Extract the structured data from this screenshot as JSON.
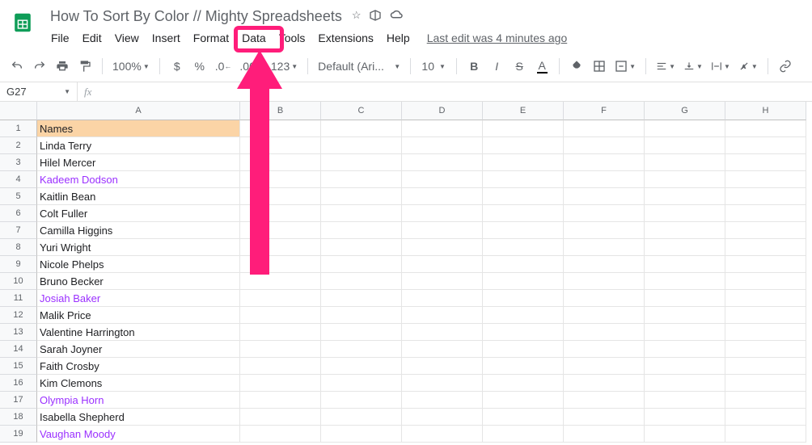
{
  "doc": {
    "title": "How To Sort By Color // Mighty Spreadsheets"
  },
  "menubar": {
    "file": "File",
    "edit": "Edit",
    "view": "View",
    "insert": "Insert",
    "format": "Format",
    "data": "Data",
    "tools": "Tools",
    "extensions": "Extensions",
    "help": "Help",
    "last_edit": "Last edit was 4 minutes ago"
  },
  "toolbar": {
    "zoom": "100%",
    "currency": "$",
    "percent": "%",
    "dec_less": ".0",
    "dec_more": ".00",
    "numfmt": "123",
    "font": "Default (Ari...",
    "font_size": "10"
  },
  "namebox": {
    "ref": "G27"
  },
  "columns": [
    "A",
    "B",
    "C",
    "D",
    "E",
    "F",
    "G",
    "H"
  ],
  "rows": [
    {
      "n": 1,
      "a": "Names",
      "hdr": true
    },
    {
      "n": 2,
      "a": "Linda Terry"
    },
    {
      "n": 3,
      "a": "Hilel Mercer"
    },
    {
      "n": 4,
      "a": "Kadeem Dodson",
      "purple": true
    },
    {
      "n": 5,
      "a": "Kaitlin Bean"
    },
    {
      "n": 6,
      "a": "Colt Fuller"
    },
    {
      "n": 7,
      "a": "Camilla Higgins"
    },
    {
      "n": 8,
      "a": "Yuri Wright"
    },
    {
      "n": 9,
      "a": "Nicole Phelps"
    },
    {
      "n": 10,
      "a": "Bruno Becker"
    },
    {
      "n": 11,
      "a": "Josiah Baker",
      "purple": true
    },
    {
      "n": 12,
      "a": "Malik Price"
    },
    {
      "n": 13,
      "a": "Valentine Harrington"
    },
    {
      "n": 14,
      "a": "Sarah Joyner"
    },
    {
      "n": 15,
      "a": "Faith Crosby"
    },
    {
      "n": 16,
      "a": "Kim Clemons"
    },
    {
      "n": 17,
      "a": "Olympia Horn",
      "purple": true
    },
    {
      "n": 18,
      "a": "Isabella Shepherd"
    },
    {
      "n": 19,
      "a": "Vaughan Moody",
      "purple": true
    }
  ],
  "annotation": {
    "highlight_target": "data",
    "arrow_color": "#ff1d7a"
  }
}
